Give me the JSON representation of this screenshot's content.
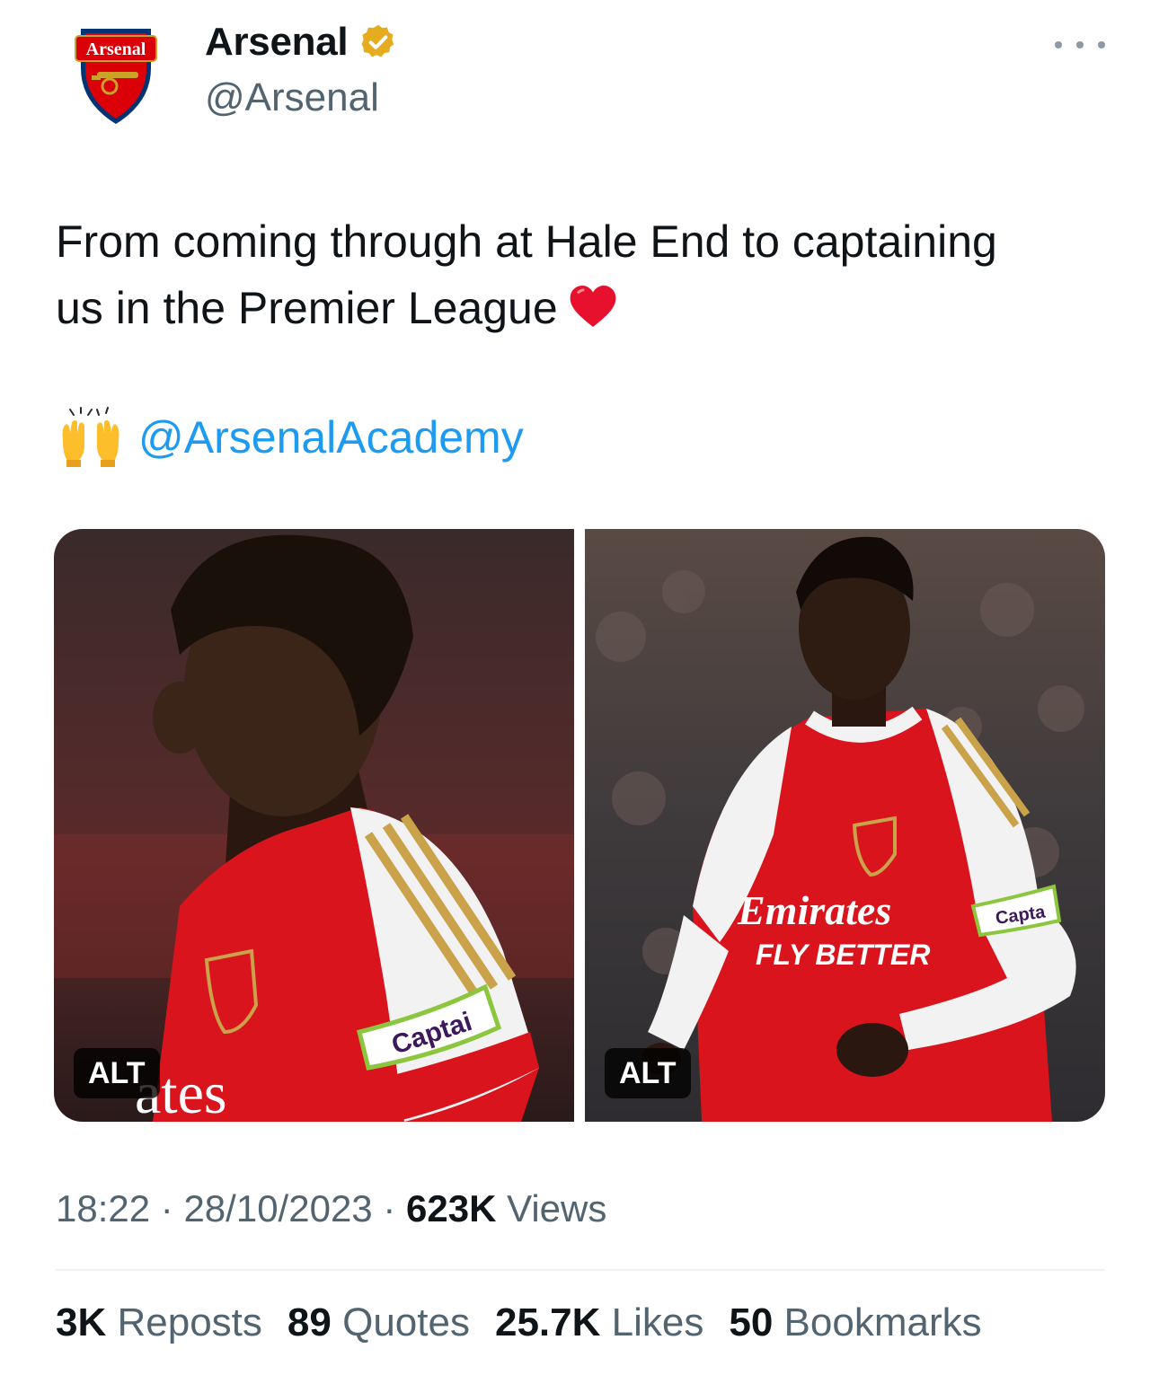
{
  "author": {
    "display_name": "Arsenal",
    "handle": "@Arsenal",
    "crest_text": "Arsenal"
  },
  "tweet": {
    "text_line1": "From coming through at Hale End to captaining",
    "text_line2": "us in the Premier League",
    "heart_emoji": "heart",
    "raised_hands_emoji": "raised-hands",
    "mention": "@ArsenalAcademy"
  },
  "media": [
    {
      "alt_label": "ALT",
      "shirt_sponsor_fragment": "ates",
      "armband_text": "Captai"
    },
    {
      "alt_label": "ALT",
      "shirt_sponsor": "Emirates",
      "shirt_tagline": "FLY BETTER",
      "armband_text": "Capta"
    }
  ],
  "meta": {
    "time": "18:22",
    "separator": "·",
    "date": "28/10/2023",
    "views_count": "623K",
    "views_label": "Views"
  },
  "stats": {
    "reposts_count": "3K",
    "reposts_label": "Reposts",
    "quotes_count": "89",
    "quotes_label": "Quotes",
    "likes_count": "25.7K",
    "likes_label": "Likes",
    "bookmarks_count": "50",
    "bookmarks_label": "Bookmarks"
  },
  "colors": {
    "link": "#1d9bf0",
    "secondary_text": "#536471",
    "primary_text": "#0f1419",
    "verified_gold": "#e6ac1f",
    "arsenal_red": "#db0007"
  }
}
